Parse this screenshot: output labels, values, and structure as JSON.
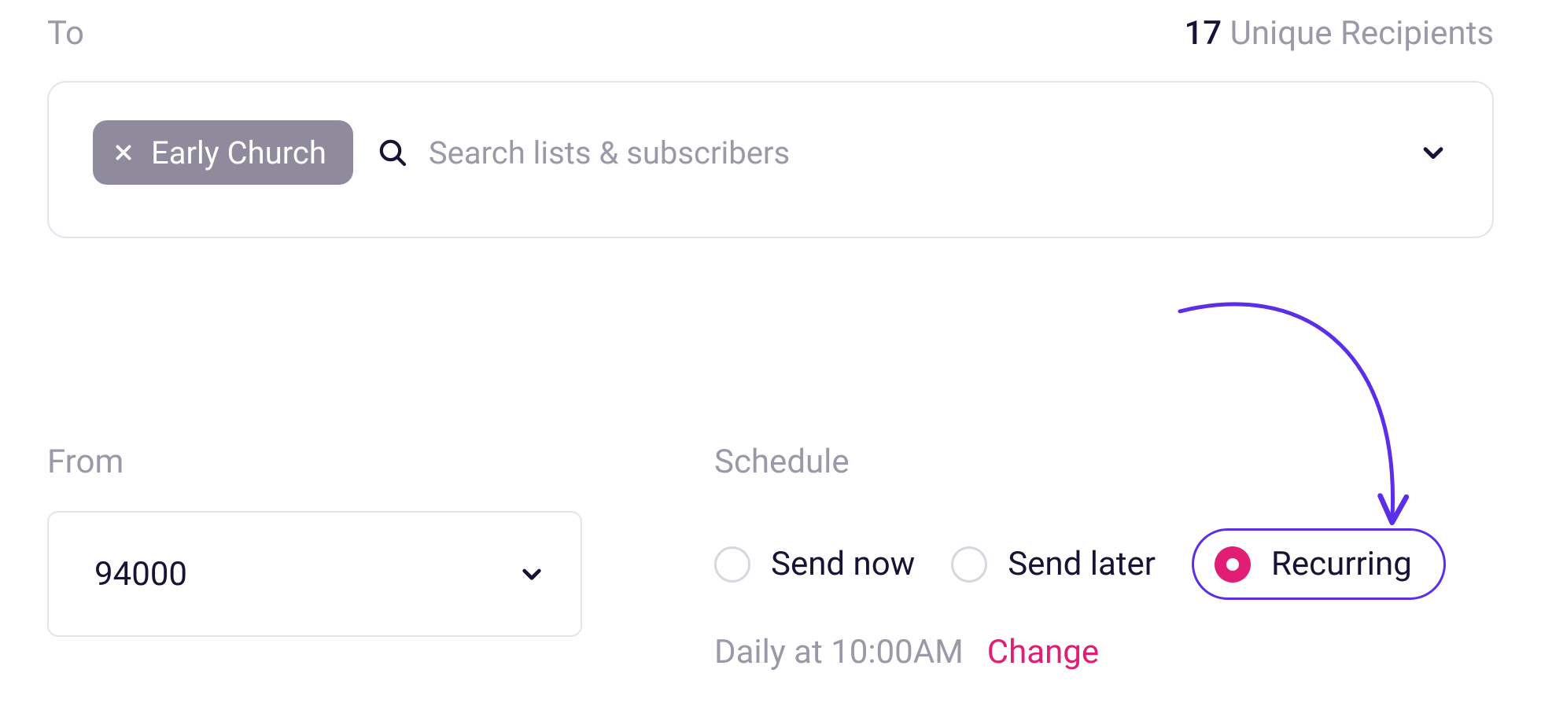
{
  "to": {
    "label": "To",
    "chip_label": "Early Church",
    "search_placeholder": "Search lists & subscribers"
  },
  "recipients": {
    "count": "17",
    "suffix": "Unique Recipients"
  },
  "from": {
    "label": "From",
    "value": "94000"
  },
  "schedule": {
    "label": "Schedule",
    "options": {
      "now": "Send now",
      "later": "Send later",
      "recurring": "Recurring"
    },
    "selected": "recurring",
    "description": "Daily at 10:00AM",
    "change_label": "Change"
  }
}
